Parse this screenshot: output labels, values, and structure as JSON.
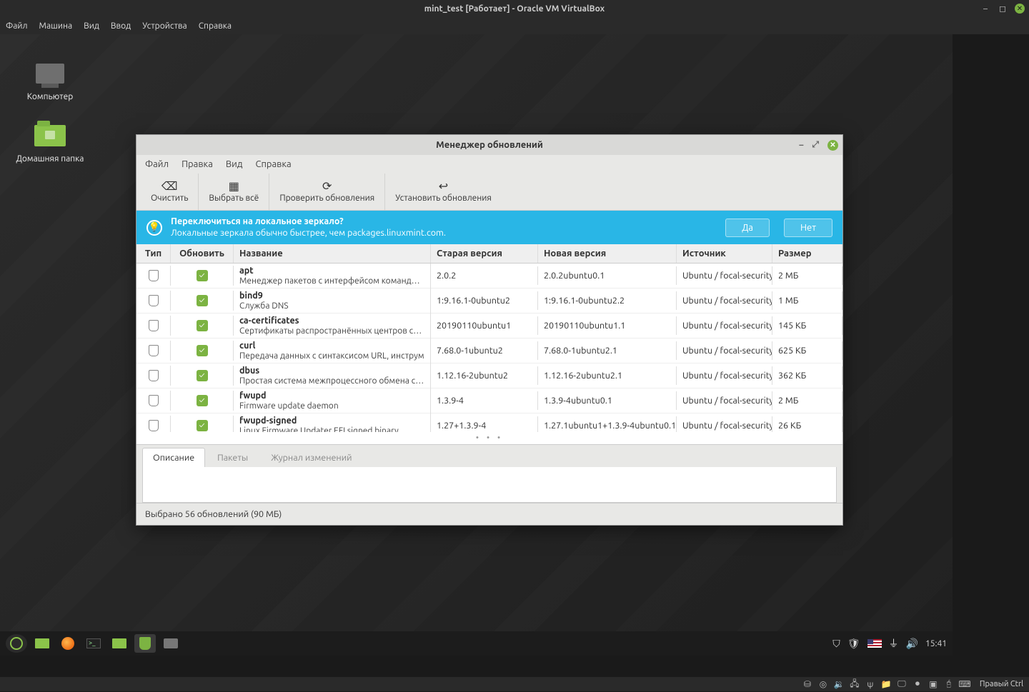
{
  "vbox": {
    "title": "mint_test [Работает] - Oracle VM VirtualBox",
    "menu": {
      "file": "Файл",
      "machine": "Машина",
      "view": "Вид",
      "input": "Ввод",
      "devices": "Устройства",
      "help": "Справка"
    },
    "hostkey": "Правый Ctrl"
  },
  "desktop": {
    "computer": "Компьютер",
    "home": "Домашняя папка"
  },
  "um": {
    "title": "Менеджер обновлений",
    "menu": {
      "file": "Файл",
      "edit": "Правка",
      "view": "Вид",
      "help": "Справка"
    },
    "toolbar": {
      "clear": "Очистить",
      "select_all": "Выбрать всё",
      "refresh": "Проверить обновления",
      "install": "Установить обновления"
    },
    "banner": {
      "question": "Переключиться на локальное зеркало?",
      "detail": "Локальные зеркала обычно быстрее, чем packages.linuxmint.com.",
      "yes": "Да",
      "no": "Нет"
    },
    "columns": {
      "type": "Тип",
      "update": "Обновить",
      "name": "Название",
      "old": "Старая версия",
      "new": "Новая версия",
      "source": "Источник",
      "size": "Размер"
    },
    "rows": [
      {
        "name": "apt",
        "desc": "Менеджер пакетов с интерфейсом командной",
        "old": "2.0.2",
        "new": "2.0.2ubuntu0.1",
        "src": "Ubuntu / focal-security",
        "size": "2 МБ"
      },
      {
        "name": "bind9",
        "desc": "Служба DNS",
        "old": "1:9.16.1-0ubuntu2",
        "new": "1:9.16.1-0ubuntu2.2",
        "src": "Ubuntu / focal-security",
        "size": "1 МБ"
      },
      {
        "name": "ca-certificates",
        "desc": "Сертификаты распространённых центров серт",
        "old": "20190110ubuntu1",
        "new": "20190110ubuntu1.1",
        "src": "Ubuntu / focal-security",
        "size": "145 КБ"
      },
      {
        "name": "curl",
        "desc": "Передача данных с синтаксисом URL, инструм",
        "old": "7.68.0-1ubuntu2",
        "new": "7.68.0-1ubuntu2.1",
        "src": "Ubuntu / focal-security",
        "size": "625 КБ"
      },
      {
        "name": "dbus",
        "desc": "Простая система межпроцессного обмена соо",
        "old": "1.12.16-2ubuntu2",
        "new": "1.12.16-2ubuntu2.1",
        "src": "Ubuntu / focal-security",
        "size": "362 КБ"
      },
      {
        "name": "fwupd",
        "desc": "Firmware update daemon",
        "old": "1.3.9-4",
        "new": "1.3.9-4ubuntu0.1",
        "src": "Ubuntu / focal-security",
        "size": "2 МБ"
      },
      {
        "name": "fwupd-signed",
        "desc": "Linux Firmware Updater EFI signed binary",
        "old": "1.27+1.3.9-4",
        "new": "1.27.1ubuntu1+1.3.9-4ubuntu0.1",
        "src": "Ubuntu / focal-security",
        "size": "26 КБ"
      }
    ],
    "tabs": {
      "desc": "Описание",
      "packages": "Пакеты",
      "changelog": "Журнал изменений"
    },
    "status": "Выбрано 56 обновлений (90 МБ)"
  },
  "guest_tray": {
    "time": "15:41"
  }
}
